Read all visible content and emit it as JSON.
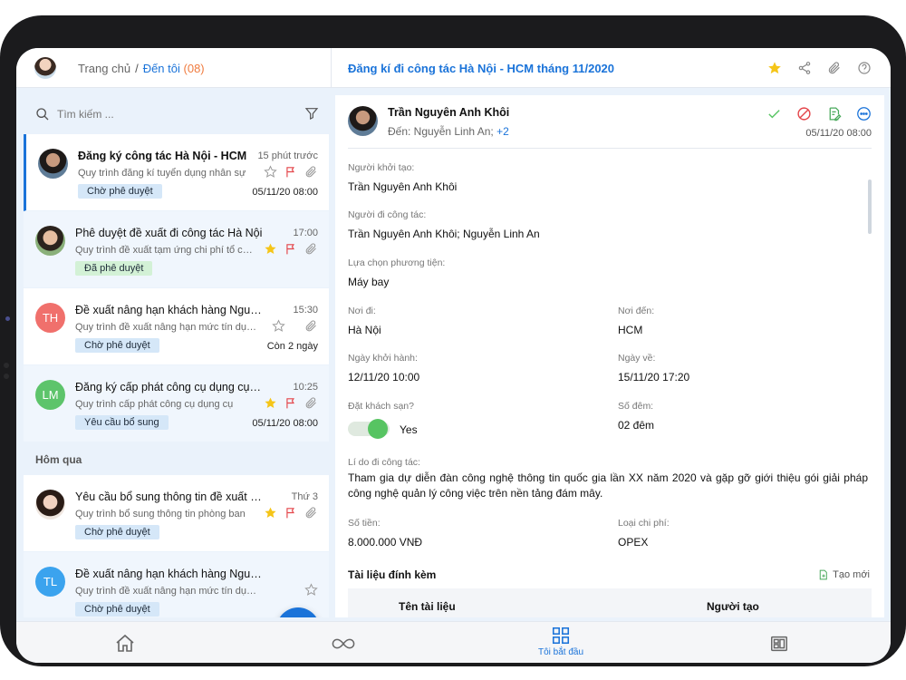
{
  "header": {
    "breadcrumb_home": "Trang chủ",
    "breadcrumb_separator": "/",
    "breadcrumb_current": "Đến tôi",
    "breadcrumb_count": "(08)",
    "document_title": "Đăng kí đi công tác Hà Nội - HCM tháng 11/2020",
    "icons": [
      "star-icon",
      "share-icon",
      "paperclip-icon",
      "settings-icon"
    ]
  },
  "search": {
    "placeholder": "Tìm kiếm ..."
  },
  "list": {
    "items": [
      {
        "title": "Đăng ký công tác Hà Nội - HCM",
        "time": "15 phút trước",
        "subtitle": "Quy trình đăng kí tuyển dụng nhân sự",
        "badge": "Chờ phê duyệt",
        "date": "05/11/20  08:00",
        "starred": false
      },
      {
        "title": "Phê duyệt đề xuất đi công tác Hà Nội",
        "time": "17:00",
        "subtitle": "Quy trình đề xuất tạm ứng chi phí tổ chức",
        "badge": "Đã phê duyệt",
        "date": "",
        "starred": true
      },
      {
        "avatar_initials": "TH",
        "avatar_color": "#f0706c",
        "title": "Đề xuất nâng hạn khách hàng Nguyễn Văn A",
        "time": "15:30",
        "subtitle": "Quy trình đề xuất nâng hạn mức tín dụng",
        "badge": "Chờ phê duyệt",
        "date": "Còn 2 ngày",
        "starred": false
      },
      {
        "avatar_initials": "LM",
        "avatar_color": "#5dc46b",
        "title": "Đăng ký cấp phát công cụ dụng cụ văn phòng",
        "time": "10:25",
        "subtitle": "Quy trình cấp phát công cụ dụng cụ",
        "badge": "Yêu cầu bổ sung",
        "date": "05/11/20  08:00",
        "starred": true
      }
    ],
    "section_yesterday": "Hôm qua",
    "yesterday_items": [
      {
        "title": "Yêu cầu bổ sung thông tin đề xuất mua sắm",
        "time": "Thứ 3",
        "subtitle": "Quy trình bổ sung thông tin phòng ban",
        "badge": "Chờ phê duyệt",
        "starred": true
      },
      {
        "avatar_initials": "TL",
        "avatar_color": "#3ba3ee",
        "title": "Đề xuất nâng hạn khách hàng Nguyễn Văn B",
        "subtitle": "Quy trình đề xuất nâng hạn mức tín dụng",
        "badge": "Chờ phê duyệt",
        "starred": false
      }
    ]
  },
  "detail": {
    "sender_name": "Trần Nguyên Anh Khôi",
    "to_prefix": "Đến: Nguyễn Linh An;",
    "to_more": "+2",
    "sent_date": "05/11/20  08:00",
    "fields": {
      "creator_label": "Người khởi tạo:",
      "creator_value": "Trần Nguyên Anh Khôi",
      "traveler_label": "Người đi công tác:",
      "traveler_value": "Trần Nguyên Anh Khôi; Nguyễn Linh An",
      "transport_label": "Lựa chọn phương tiện:",
      "transport_value": "Máy bay",
      "from_label": "Nơi đi:",
      "from_value": "Hà Nội",
      "dest_label": "Nơi đến:",
      "dest_value": "HCM",
      "depart_label": "Ngày khởi hành:",
      "depart_value": "12/11/20  10:00",
      "return_label": "Ngày về:",
      "return_value": "15/11/20  17:20",
      "hotel_label": "Đặt khách sạn?",
      "hotel_value": "Yes",
      "nights_label": "Số đêm:",
      "nights_value": "02 đêm",
      "reason_label": "Lí do đi công tác:",
      "reason_value": "Tham gia dự diễn đàn công nghệ thông tin quốc gia lần XX năm 2020 và gặp gỡ giới thiệu gói giải pháp công nghệ quản lý công việc trên nền tảng đám mây.",
      "amount_label": "Số tiền:",
      "amount_value": "8.000.000 VNĐ",
      "cost_type_label": "Loại chi phí:",
      "cost_type_value": "OPEX"
    },
    "attachments_title": "Tài liệu đính kèm",
    "create_new": "Tạo mới",
    "col_name": "Tên tài liệu",
    "col_creator": "Người tạo"
  },
  "bottom_nav": {
    "active_label": "Tôi bắt đầu"
  },
  "colors": {
    "accent": "#1a73d9",
    "star": "#f5c518",
    "flag": "#e4454a",
    "approve": "#57c462"
  }
}
